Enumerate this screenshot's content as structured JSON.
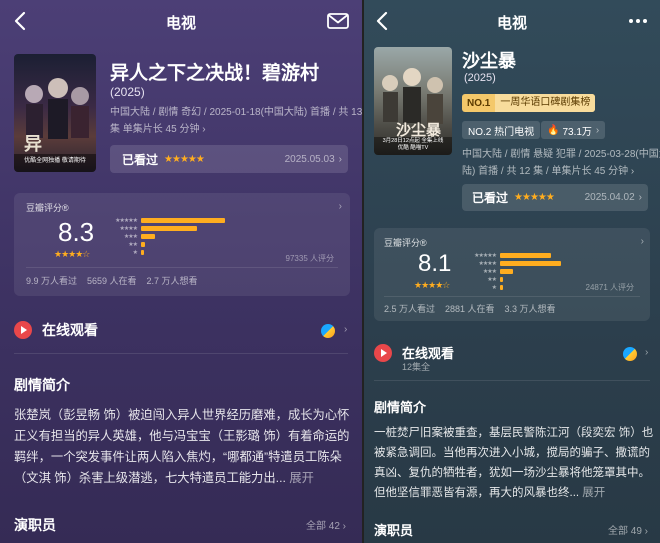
{
  "left": {
    "header": {
      "title": "电视",
      "back_icon": "chevron-left-icon",
      "right_icon": "mail-icon"
    },
    "poster": {
      "caption_1": "优酷全网独播",
      "caption_2": "敬请期待"
    },
    "movie": {
      "title": "异人之下之决战！碧游村",
      "year": "(2025)",
      "meta_line1": "中国大陆 / 剧情 奇幻 / 2025-01-18(中国大陆) 首播 / 共 13",
      "meta_line2": "集 单集片长 45 分钟 ›"
    },
    "seen": {
      "label": "已看过",
      "stars": "★★★★★",
      "date": "2025.05.03",
      "chevron": "›"
    },
    "rating": {
      "label": "豆瓣评分®",
      "score": "8.3",
      "stars": "★★★★☆",
      "count": "97335 人评分",
      "stats": "9.9 万人看过    5659 人在看    2.7 万人想看",
      "distribution": [
        0.52,
        0.35,
        0.09,
        0.025,
        0.015
      ]
    },
    "watch": {
      "label": "在线观看",
      "platform_icon": "youku-icon"
    },
    "synopsis": {
      "title": "剧情简介",
      "text": "张楚岚（彭昱畅 饰）被迫闯入异人世界经历磨难，成长为心怀正义有担当的异人英雄，他与冯宝宝（王影璐 饰）有着命运的羁绊，一个突发事件让两人陷入焦灼，“哪都通”特遣员工陈朵（文淇 饰）杀害上级潜逃，七大特遣员工能力出...",
      "expand": "展开"
    },
    "cast": {
      "title": "演职员",
      "all": "全部 42 ›"
    }
  },
  "right": {
    "header": {
      "title": "电视",
      "back_icon": "chevron-left-icon",
      "right_icon": "more-icon"
    },
    "poster": {
      "caption_1": "3月28日12点起",
      "caption_2": "全集上线",
      "caption_3": "优酷 酷喵TV"
    },
    "movie": {
      "title": "沙尘暴",
      "year": "(2025)",
      "meta_line1": "中国大陆 / 剧情 悬疑 犯罪 / 2025-03-28(中国大",
      "meta_line2": "陆) 首播 / 共 12 集 / 单集片长 45 分钟 ›"
    },
    "badges": {
      "rank1": "NO.1",
      "rank1_text": "一周华语口碑剧集榜",
      "rank2": "NO.2 热门电视",
      "heat": "73.1万"
    },
    "seen": {
      "label": "已看过",
      "stars": "★★★★★",
      "date": "2025.04.02",
      "chevron": "›"
    },
    "rating": {
      "label": "豆瓣评分®",
      "score": "8.1",
      "stars": "★★★★☆",
      "count": "24871 人评分",
      "stats": "2.5 万人看过    2881 人在看    3.3 万人想看",
      "distribution": [
        0.4,
        0.48,
        0.1,
        0.015,
        0.01
      ]
    },
    "watch": {
      "label": "在线观看",
      "sub": "12集全",
      "platform_icon": "youku-icon"
    },
    "synopsis": {
      "title": "剧情简介",
      "text": "一桩焚尸旧案被重查，基层民警陈江河（段奕宏 饰）也被紧急调回。当他再次进入小城，搅局的骗子、撒谎的真凶、复仇的牺牲者，犹如一场沙尘暴将他笼罩其中。但他坚信罪恶皆有源，再大的风暴也终...",
      "expand": "展开"
    },
    "cast": {
      "title": "演职员",
      "all": "全部 49 ›"
    }
  },
  "colors": {
    "star": "#ffad1f",
    "play": "#e9474a",
    "left_bg": "#443868",
    "right_bg": "#2f4553"
  }
}
